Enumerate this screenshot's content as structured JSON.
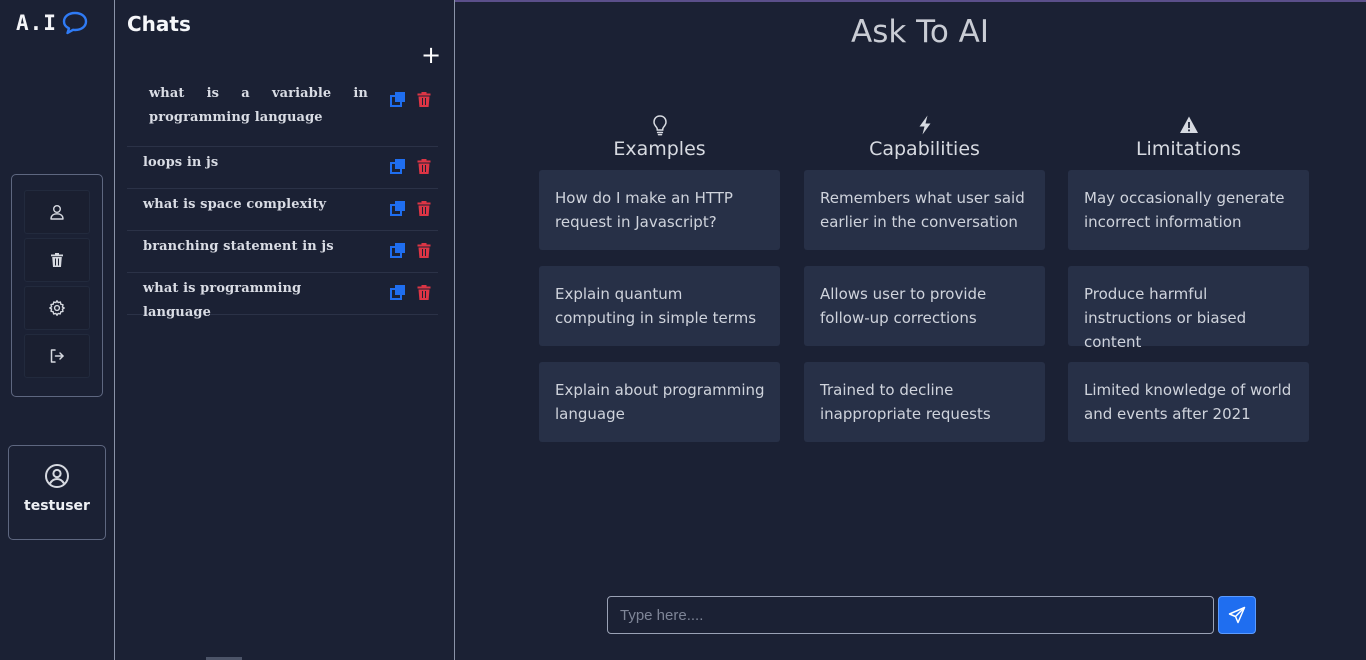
{
  "brand": {
    "logo_text": "A.I",
    "logo_icon": "chat-bubble-icon"
  },
  "rail": {
    "tools": [
      {
        "name": "profile",
        "icon": "user-icon"
      },
      {
        "name": "delete",
        "icon": "trash-icon"
      },
      {
        "name": "settings",
        "icon": "gear-icon"
      },
      {
        "name": "logout",
        "icon": "logout-icon"
      }
    ],
    "user": {
      "name": "testuser",
      "icon": "user-circle-icon"
    }
  },
  "chats": {
    "title": "Chats",
    "new_label": "+",
    "items": [
      {
        "label": "what is a variable in programming language"
      },
      {
        "label": "loops in js"
      },
      {
        "label": "what is space complexity"
      },
      {
        "label": "branching statement in js"
      },
      {
        "label": "what is programming language"
      }
    ]
  },
  "main": {
    "title": "Ask To AI",
    "columns": [
      {
        "title": "Examples",
        "icon": "lightbulb-icon",
        "cards": [
          "How do I make an HTTP request in Javascript?",
          "Explain quantum computing in simple terms",
          "Explain about programming language"
        ]
      },
      {
        "title": "Capabilities",
        "icon": "lightning-icon",
        "cards": [
          "Remembers what user said earlier in the conversation",
          "Allows user to provide follow-up corrections",
          "Trained to decline inappropriate requests"
        ]
      },
      {
        "title": "Limitations",
        "icon": "warning-icon",
        "cards": [
          "May occasionally generate incorrect information",
          "Produce harmful instructions or biased content",
          "Limited knowledge of world and events after 2021"
        ]
      }
    ],
    "input": {
      "placeholder": "Type here....",
      "value": ""
    },
    "send_icon": "send-icon"
  },
  "colors": {
    "background": "#1b2134",
    "card": "#273047",
    "accent": "#1f6ef0",
    "danger": "#dc3545"
  }
}
